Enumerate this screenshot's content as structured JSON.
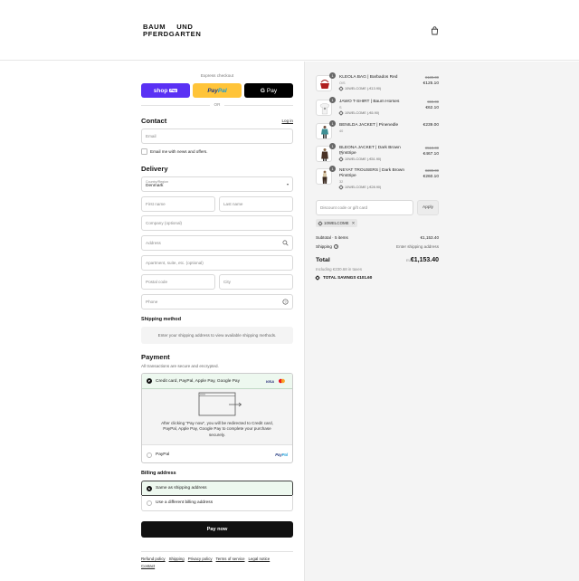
{
  "brand": {
    "line1_a": "BAUM",
    "line1_b": "UND",
    "line2": "PFERDGARTEN"
  },
  "header": {
    "cart_icon": "shopping-bag-icon"
  },
  "express": {
    "label": "Express checkout",
    "shop_pay": "shop",
    "shop_pay_badge": "Pay",
    "paypal_a": "Pay",
    "paypal_b": "Pal",
    "gpay_g": "G",
    "gpay_text": "Pay",
    "or": "OR"
  },
  "contact": {
    "title": "Contact",
    "login": "Log in",
    "email_placeholder": "Email",
    "newsletter": "Email me with news and offers."
  },
  "delivery": {
    "title": "Delivery",
    "country_label": "Country/Region",
    "country_value": "Denmark",
    "first_name": "First name",
    "last_name": "Last name",
    "company": "Company (optional)",
    "address": "Address",
    "apartment": "Apartment, suite, etc. (optional)",
    "postal": "Postal code",
    "city": "City",
    "phone": "Phone"
  },
  "shipping_method": {
    "title": "Shipping method",
    "info": "Enter your shipping address to view available shipping methods."
  },
  "payment": {
    "title": "Payment",
    "subtitle": "All transactions are secure and encrypted.",
    "option1": "Credit card, PayPal, Apple Pay, Google Pay",
    "visa": "VISA",
    "redirect_msg": "After clicking “Pay now”, you will be redirected to Credit card, PayPal, Apple Pay, Google Pay to complete your purchase securely.",
    "option2": "PayPal",
    "pp_a": "Pay",
    "pp_b": "Pal"
  },
  "billing": {
    "title": "Billing address",
    "same": "Same as shipping address",
    "different": "Use a different billing address"
  },
  "pay_now": "Pay now",
  "footer": [
    "Refund policy",
    "Shipping",
    "Privacy policy",
    "Terms of service",
    "Legal notice",
    "Contact"
  ],
  "items": [
    {
      "qty": "1",
      "name": "KLEOLA BAG | Barbados Red",
      "variant": "O/S",
      "discount": "10WELCOME (-€13.90)",
      "orig": "€139.00",
      "price": "€125.10"
    },
    {
      "qty": "1",
      "name": "JAWO T-SHIRT | Baum Horses",
      "variant": "S",
      "discount": "10WELCOME (-€6.90)",
      "orig": "€69.00",
      "price": "€62.10"
    },
    {
      "qty": "1",
      "name": "BENILDA JACKET | Pinenedle",
      "variant": "40",
      "discount": "",
      "orig": "",
      "price": "€239.00"
    },
    {
      "qty": "1",
      "name": "BLEONA JACKET | Dark Brown Pinstripe",
      "variant": "34",
      "discount": "10WELCOME (-€51.90)",
      "orig": "€519.00",
      "price": "€467.10"
    },
    {
      "qty": "1",
      "name": "NEYAT TROUSERS | Dark Brown Pinstripe",
      "variant": "32",
      "discount": "10WELCOME (-€28.90)",
      "orig": "€289.00",
      "price": "€260.10"
    }
  ],
  "discount": {
    "placeholder": "Discount code or gift card",
    "apply": "Apply",
    "applied_code": "10WELCOME"
  },
  "summary": {
    "subtotal_label": "Subtotal · 5 items",
    "subtotal_value": "€1,153.40",
    "shipping_label": "Shipping",
    "shipping_value": "Enter shipping address",
    "total_label": "Total",
    "currency": "EUR",
    "total_value": "€1,153.40",
    "tax": "Including €230.68 in taxes",
    "savings": "TOTAL SAVINGS  €101.60"
  }
}
